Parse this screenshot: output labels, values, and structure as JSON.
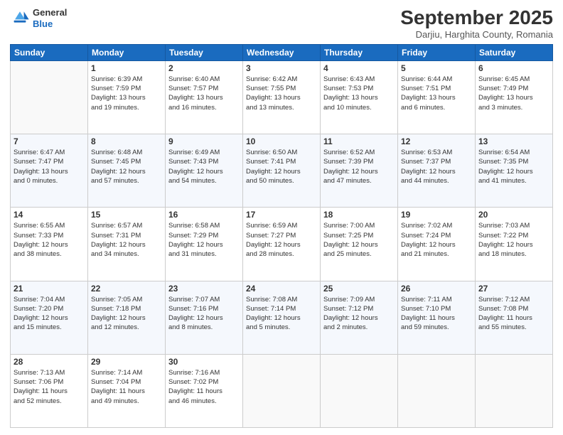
{
  "logo": {
    "line1": "General",
    "line2": "Blue"
  },
  "title": "September 2025",
  "subtitle": "Darjiu, Harghita County, Romania",
  "weekdays": [
    "Sunday",
    "Monday",
    "Tuesday",
    "Wednesday",
    "Thursday",
    "Friday",
    "Saturday"
  ],
  "weeks": [
    [
      {
        "day": "",
        "info": ""
      },
      {
        "day": "1",
        "info": "Sunrise: 6:39 AM\nSunset: 7:59 PM\nDaylight: 13 hours\nand 19 minutes."
      },
      {
        "day": "2",
        "info": "Sunrise: 6:40 AM\nSunset: 7:57 PM\nDaylight: 13 hours\nand 16 minutes."
      },
      {
        "day": "3",
        "info": "Sunrise: 6:42 AM\nSunset: 7:55 PM\nDaylight: 13 hours\nand 13 minutes."
      },
      {
        "day": "4",
        "info": "Sunrise: 6:43 AM\nSunset: 7:53 PM\nDaylight: 13 hours\nand 10 minutes."
      },
      {
        "day": "5",
        "info": "Sunrise: 6:44 AM\nSunset: 7:51 PM\nDaylight: 13 hours\nand 6 minutes."
      },
      {
        "day": "6",
        "info": "Sunrise: 6:45 AM\nSunset: 7:49 PM\nDaylight: 13 hours\nand 3 minutes."
      }
    ],
    [
      {
        "day": "7",
        "info": "Sunrise: 6:47 AM\nSunset: 7:47 PM\nDaylight: 13 hours\nand 0 minutes."
      },
      {
        "day": "8",
        "info": "Sunrise: 6:48 AM\nSunset: 7:45 PM\nDaylight: 12 hours\nand 57 minutes."
      },
      {
        "day": "9",
        "info": "Sunrise: 6:49 AM\nSunset: 7:43 PM\nDaylight: 12 hours\nand 54 minutes."
      },
      {
        "day": "10",
        "info": "Sunrise: 6:50 AM\nSunset: 7:41 PM\nDaylight: 12 hours\nand 50 minutes."
      },
      {
        "day": "11",
        "info": "Sunrise: 6:52 AM\nSunset: 7:39 PM\nDaylight: 12 hours\nand 47 minutes."
      },
      {
        "day": "12",
        "info": "Sunrise: 6:53 AM\nSunset: 7:37 PM\nDaylight: 12 hours\nand 44 minutes."
      },
      {
        "day": "13",
        "info": "Sunrise: 6:54 AM\nSunset: 7:35 PM\nDaylight: 12 hours\nand 41 minutes."
      }
    ],
    [
      {
        "day": "14",
        "info": "Sunrise: 6:55 AM\nSunset: 7:33 PM\nDaylight: 12 hours\nand 38 minutes."
      },
      {
        "day": "15",
        "info": "Sunrise: 6:57 AM\nSunset: 7:31 PM\nDaylight: 12 hours\nand 34 minutes."
      },
      {
        "day": "16",
        "info": "Sunrise: 6:58 AM\nSunset: 7:29 PM\nDaylight: 12 hours\nand 31 minutes."
      },
      {
        "day": "17",
        "info": "Sunrise: 6:59 AM\nSunset: 7:27 PM\nDaylight: 12 hours\nand 28 minutes."
      },
      {
        "day": "18",
        "info": "Sunrise: 7:00 AM\nSunset: 7:25 PM\nDaylight: 12 hours\nand 25 minutes."
      },
      {
        "day": "19",
        "info": "Sunrise: 7:02 AM\nSunset: 7:24 PM\nDaylight: 12 hours\nand 21 minutes."
      },
      {
        "day": "20",
        "info": "Sunrise: 7:03 AM\nSunset: 7:22 PM\nDaylight: 12 hours\nand 18 minutes."
      }
    ],
    [
      {
        "day": "21",
        "info": "Sunrise: 7:04 AM\nSunset: 7:20 PM\nDaylight: 12 hours\nand 15 minutes."
      },
      {
        "day": "22",
        "info": "Sunrise: 7:05 AM\nSunset: 7:18 PM\nDaylight: 12 hours\nand 12 minutes."
      },
      {
        "day": "23",
        "info": "Sunrise: 7:07 AM\nSunset: 7:16 PM\nDaylight: 12 hours\nand 8 minutes."
      },
      {
        "day": "24",
        "info": "Sunrise: 7:08 AM\nSunset: 7:14 PM\nDaylight: 12 hours\nand 5 minutes."
      },
      {
        "day": "25",
        "info": "Sunrise: 7:09 AM\nSunset: 7:12 PM\nDaylight: 12 hours\nand 2 minutes."
      },
      {
        "day": "26",
        "info": "Sunrise: 7:11 AM\nSunset: 7:10 PM\nDaylight: 11 hours\nand 59 minutes."
      },
      {
        "day": "27",
        "info": "Sunrise: 7:12 AM\nSunset: 7:08 PM\nDaylight: 11 hours\nand 55 minutes."
      }
    ],
    [
      {
        "day": "28",
        "info": "Sunrise: 7:13 AM\nSunset: 7:06 PM\nDaylight: 11 hours\nand 52 minutes."
      },
      {
        "day": "29",
        "info": "Sunrise: 7:14 AM\nSunset: 7:04 PM\nDaylight: 11 hours\nand 49 minutes."
      },
      {
        "day": "30",
        "info": "Sunrise: 7:16 AM\nSunset: 7:02 PM\nDaylight: 11 hours\nand 46 minutes."
      },
      {
        "day": "",
        "info": ""
      },
      {
        "day": "",
        "info": ""
      },
      {
        "day": "",
        "info": ""
      },
      {
        "day": "",
        "info": ""
      }
    ]
  ]
}
